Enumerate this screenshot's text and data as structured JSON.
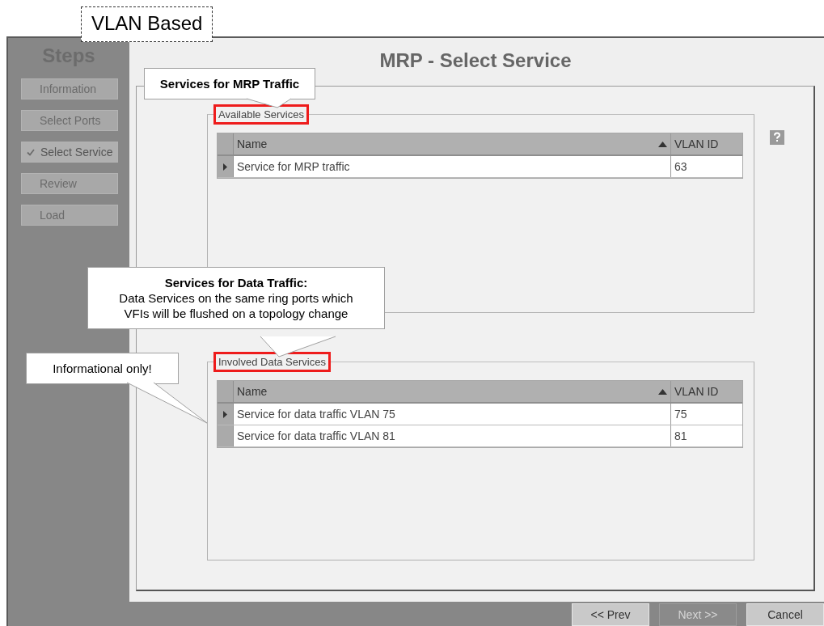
{
  "label": "VLAN Based",
  "sidebar": {
    "title": "Steps",
    "items": [
      {
        "label": "Information",
        "selected": false
      },
      {
        "label": "Select Ports",
        "selected": false
      },
      {
        "label": "Select Service",
        "selected": true
      },
      {
        "label": "Review",
        "selected": false
      },
      {
        "label": "Load",
        "selected": false
      }
    ]
  },
  "title": "MRP - Select Service",
  "groups": [
    {
      "legend": "Available Services",
      "highlighted": true,
      "columns": [
        {
          "label": "Name",
          "sorted": true
        },
        {
          "label": "VLAN ID",
          "sorted": false
        }
      ],
      "rows": [
        {
          "cells": [
            "Service for MRP traffic",
            "63"
          ],
          "current": true
        }
      ]
    },
    {
      "legend": "Involved Data Services",
      "highlighted": true,
      "columns": [
        {
          "label": "Name",
          "sorted": true
        },
        {
          "label": "VLAN ID",
          "sorted": false
        }
      ],
      "rows": [
        {
          "cells": [
            "Service for data traffic VLAN 75",
            "75"
          ],
          "current": true
        },
        {
          "cells": [
            "Service for data traffic VLAN 81",
            "81"
          ],
          "current": false
        }
      ]
    }
  ],
  "buttons": [
    {
      "label": "<< Prev",
      "disabled": false
    },
    {
      "label": "Next >>",
      "disabled": true
    },
    {
      "label": "Cancel",
      "disabled": false
    }
  ],
  "callouts": [
    {
      "title": "Services for MRP Traffic"
    },
    {
      "title": "Services for Data Traffic:",
      "lines": [
        "Data Services on the same ring ports which",
        "VFIs will be flushed on a topology change"
      ]
    },
    {
      "lines": [
        "Informational only!"
      ]
    }
  ]
}
